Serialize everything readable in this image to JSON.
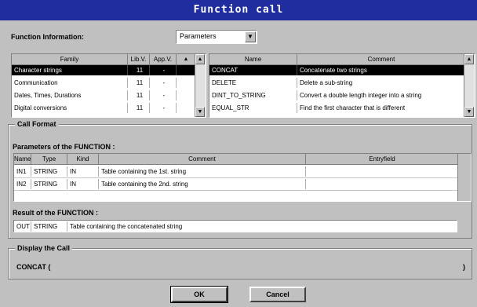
{
  "window": {
    "title": "Function call"
  },
  "function_info": {
    "label": "Function Information:",
    "dropdown_value": "Parameters"
  },
  "families_table": {
    "headers": [
      "Family",
      "Lib.V.",
      "App.V."
    ],
    "rows": [
      [
        "Character strings",
        "11",
        "-"
      ],
      [
        "Communication",
        "11",
        "-"
      ],
      [
        "Dates, Times, Durations",
        "11",
        "-"
      ],
      [
        "Digital conversions",
        "11",
        "-"
      ]
    ]
  },
  "functions_table": {
    "headers": [
      "Name",
      "Comment"
    ],
    "rows": [
      [
        "CONCAT",
        "Concatenate two strings"
      ],
      [
        "DELETE",
        "Delete a sub-string"
      ],
      [
        "DINT_TO_STRING",
        "Convert a double length integer into a string"
      ],
      [
        "EQUAL_STR",
        "Find the first character that is different"
      ]
    ]
  },
  "call_format": {
    "group_label": "Call Format",
    "params_label": "Parameters of the FUNCTION :",
    "params_headers": [
      "Name",
      "Type",
      "Kind",
      "Comment",
      "Entryfield"
    ],
    "params_rows": [
      [
        "IN1",
        "STRING",
        "IN",
        "Table containing the 1st. string",
        ""
      ],
      [
        "IN2",
        "STRING",
        "IN",
        "Table containing the 2nd. string",
        ""
      ]
    ],
    "result_label": "Result of the FUNCTION :",
    "result_row": [
      "OUT",
      "STRING",
      "Table containing the concatenated string"
    ]
  },
  "display_call": {
    "group_label": "Display the Call",
    "text": "CONCAT (",
    "close": ")"
  },
  "buttons": {
    "ok": "OK",
    "cancel": "Cancel"
  }
}
